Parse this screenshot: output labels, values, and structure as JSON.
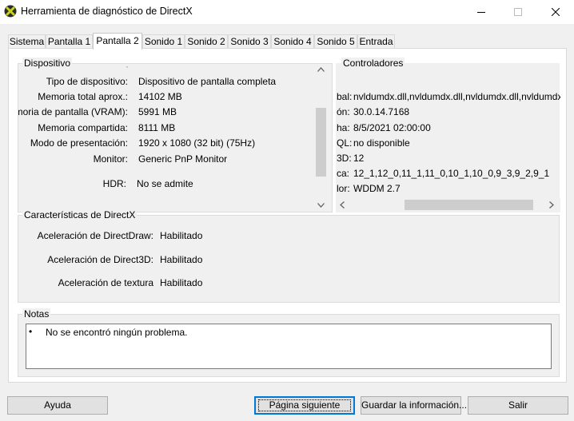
{
  "window": {
    "title": "Herramienta de diagnóstico de DirectX"
  },
  "tabs": [
    {
      "label": "Sistema"
    },
    {
      "label": "Pantalla 1"
    },
    {
      "label": "Pantalla 2"
    },
    {
      "label": "Sonido 1"
    },
    {
      "label": "Sonido 2"
    },
    {
      "label": "Sonido 3"
    },
    {
      "label": "Sonido 4"
    },
    {
      "label": "Sonido 5"
    },
    {
      "label": "Entrada"
    }
  ],
  "device": {
    "group_title": "Dispositivo",
    "rows": [
      {
        "label": "Tipo de dispositivo:",
        "value": "Dispositivo de pantalla completa"
      },
      {
        "label": "Memoria total aprox.:",
        "value": "14102 MB"
      },
      {
        "label": "Memoria de pantalla (VRAM):",
        "value": "5991 MB"
      },
      {
        "label": "Memoria compartida:",
        "value": "8111 MB"
      },
      {
        "label": "Modo de presentación:",
        "value": "1920 x 1080 (32 bit) (75Hz)"
      },
      {
        "label": "Monitor:",
        "value": "Generic PnP Monitor"
      },
      {
        "label": "HDR:",
        "value": "No se admite"
      }
    ]
  },
  "drivers": {
    "group_title": "Controladores",
    "rows": [
      {
        "label": "bal:",
        "value": "nvldumdx.dll,nvldumdx.dll,nvldumdx.dll,nvldumdx.dll"
      },
      {
        "label": "ón:",
        "value": "30.0.14.7168"
      },
      {
        "label": "ha:",
        "value": "8/5/2021 02:00:00"
      },
      {
        "label": "QL:",
        "value": "no disponible"
      },
      {
        "label": "3D:",
        "value": "12"
      },
      {
        "label": "ca:",
        "value": "12_1,12_0,11_1,11_0,10_1,10_0,9_3,9_2,9_1"
      },
      {
        "label": "lor:",
        "value": "WDDM 2.7"
      }
    ]
  },
  "directx_features": {
    "group_title": "Características de DirectX",
    "rows": [
      {
        "label": "Aceleración de DirectDraw:",
        "value": "Habilitado"
      },
      {
        "label": "Aceleración de Direct3D:",
        "value": "Habilitado"
      },
      {
        "label": "Aceleración de textura",
        "value": "Habilitado"
      }
    ]
  },
  "notes": {
    "group_title": "Notas",
    "items": [
      "No se encontró ningún problema."
    ]
  },
  "buttons": {
    "help": "Ayuda",
    "next_page": "Página siguiente",
    "save_info": "Guardar la información...",
    "exit": "Salir"
  },
  "icons": {
    "app": "directx-x-icon",
    "minimize": "minimize-icon",
    "maximize": "maximize-icon",
    "close": "close-icon"
  }
}
